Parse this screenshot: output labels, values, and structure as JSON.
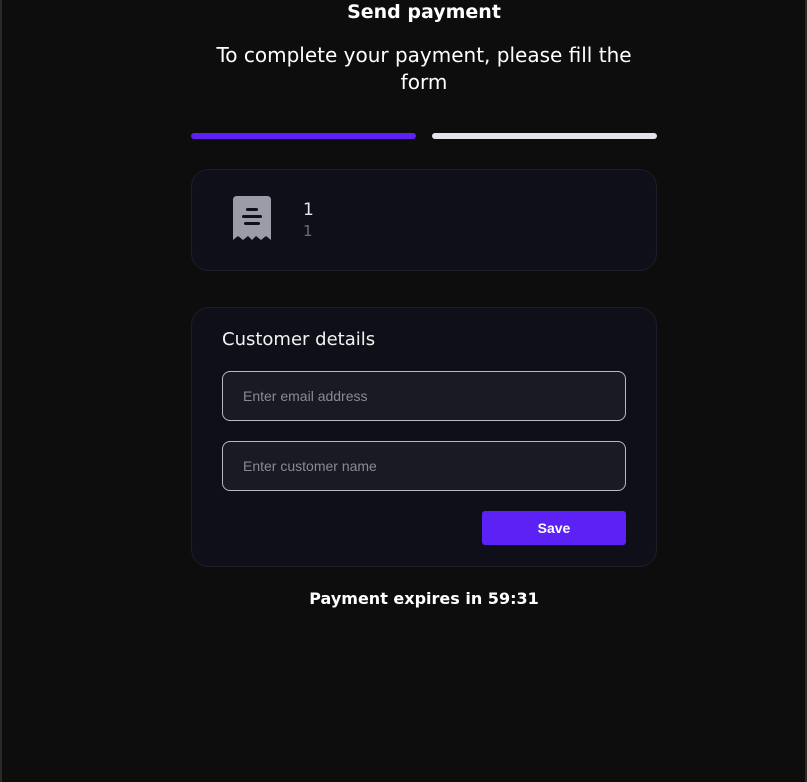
{
  "page": {
    "title": "Send payment",
    "subtitle": "To complete your payment, please fill the form"
  },
  "progress": {
    "current_step": 1,
    "total_steps": 2,
    "active_color": "#5b21f5",
    "inactive_color": "#e2e4ea"
  },
  "item": {
    "icon": "receipt-icon",
    "primary": "1",
    "secondary": "1"
  },
  "customer_form": {
    "heading": "Customer details",
    "email_placeholder": "Enter email address",
    "email_value": "",
    "name_placeholder": "Enter customer name",
    "name_value": "",
    "save_label": "Save"
  },
  "expiry": {
    "text": "Payment expires in 59:31"
  },
  "colors": {
    "background": "#0d0d0d",
    "card": "#0f0f1a",
    "accent": "#5b21f5"
  }
}
